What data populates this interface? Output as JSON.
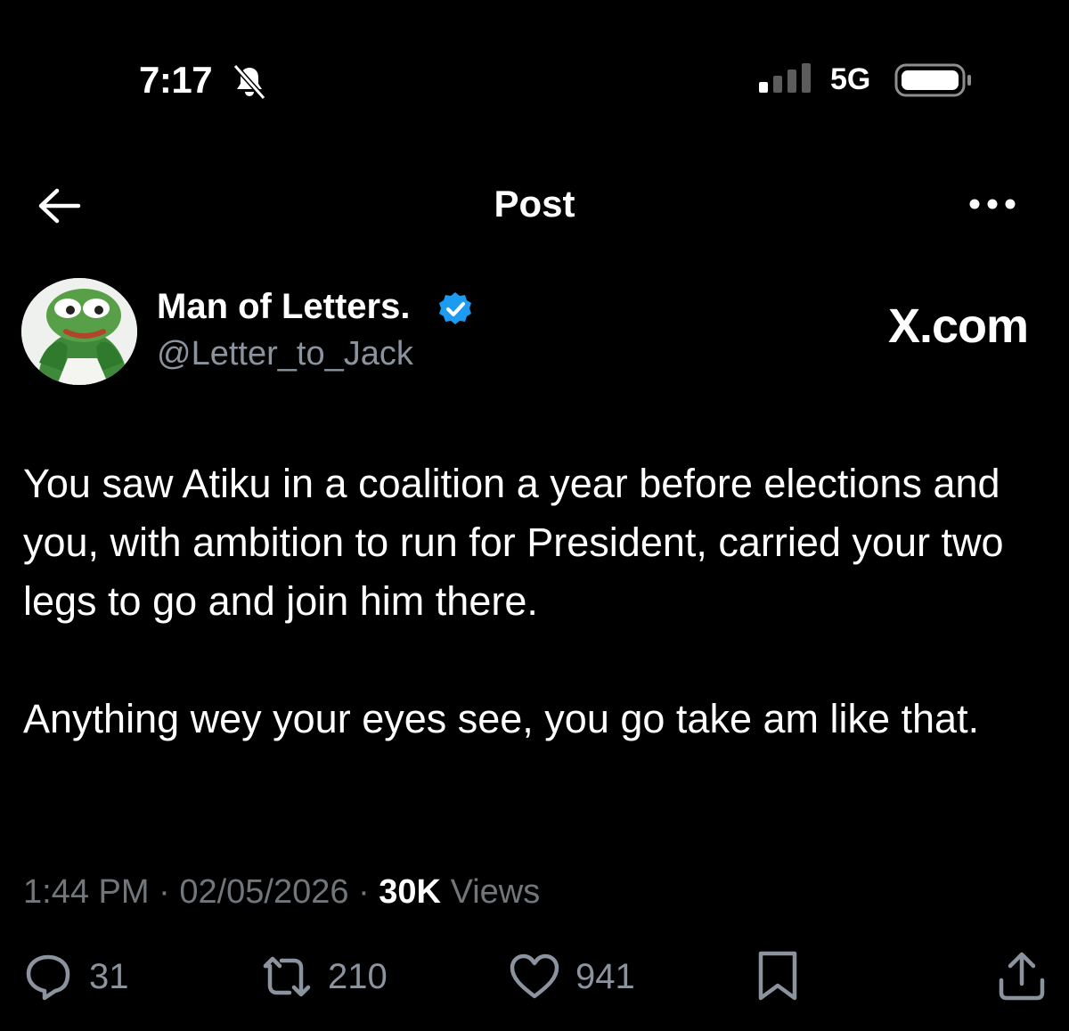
{
  "status_bar": {
    "time": "7:17",
    "network": "5G",
    "icons": [
      "bell-slash-icon",
      "signal-icon",
      "battery-icon"
    ]
  },
  "header": {
    "title": "Post",
    "icons": [
      "back-arrow-icon",
      "more-icon"
    ]
  },
  "author": {
    "name": "Man of Letters.",
    "handle": "@Letter_to_Jack",
    "verified": true,
    "verified_color": "#1d9bf0"
  },
  "watermark": "X.com",
  "post": {
    "paragraphs": [
      "You saw Atiku in a coalition a year before elections and you, with ambition to run for President, carried your two legs to go and join him there.",
      "Anything wey your eyes see, you go take am like that."
    ],
    "time": "1:44 PM",
    "date": "02/05/2026",
    "views_count": "30K",
    "views_label": "Views",
    "separator": "·"
  },
  "actions": {
    "replies": "31",
    "reposts": "210",
    "likes": "941",
    "icons": [
      "reply-icon",
      "repost-icon",
      "like-icon",
      "bookmark-icon",
      "share-icon"
    ]
  },
  "colors": {
    "background": "#000000",
    "text": "#ffffff",
    "secondary": "#71767b",
    "accent": "#1d9bf0"
  }
}
